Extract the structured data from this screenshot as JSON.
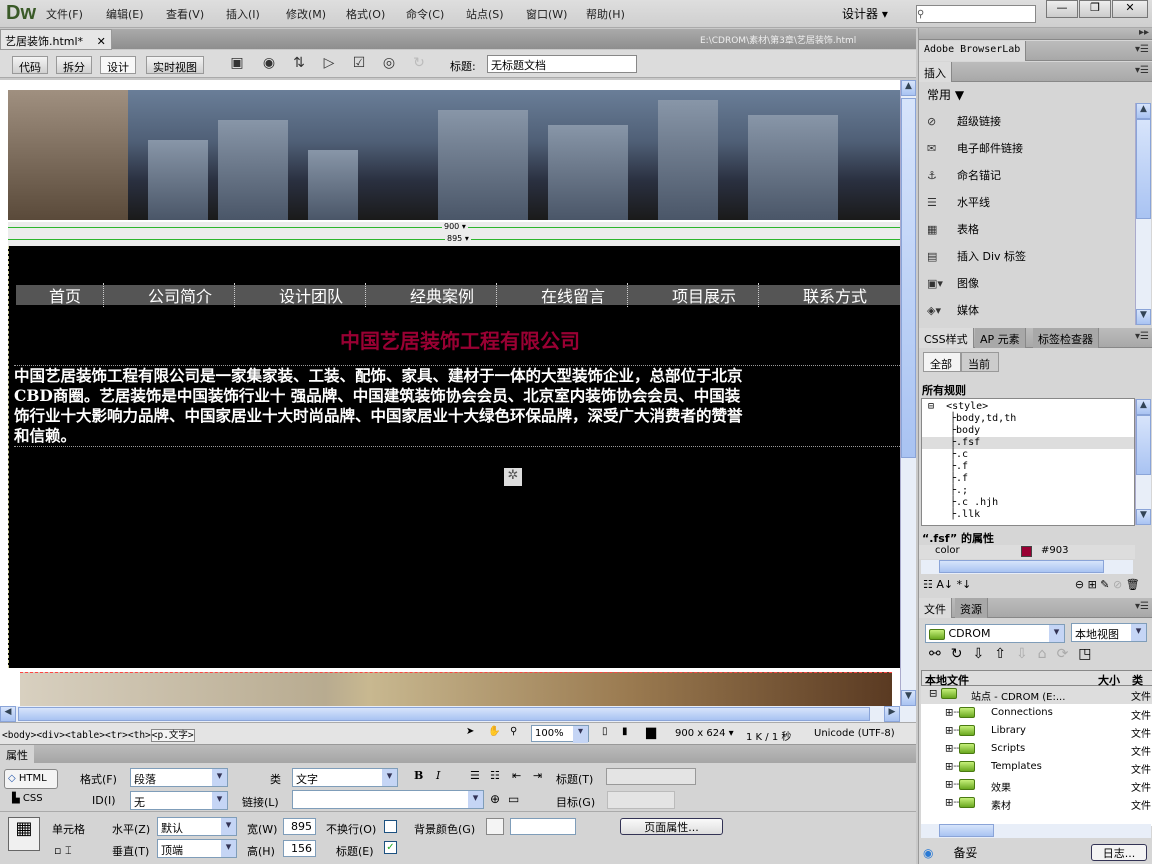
{
  "app": {
    "logo": "Dw",
    "menu": [
      "文件(F)",
      "编辑(E)",
      "查看(V)",
      "插入(I)",
      "修改(M)",
      "格式(O)",
      "命令(C)",
      "站点(S)",
      "窗口(W)",
      "帮助(H)"
    ],
    "workspace": "设计器 ▾",
    "window_buttons": [
      "—",
      "❐",
      "✕"
    ]
  },
  "document": {
    "tab": "艺居装饰.html*",
    "close": "✕",
    "path": "E:\\CDROM\\素材\\第3章\\艺居装饰.html"
  },
  "toolbar": {
    "views": [
      "代码",
      "拆分",
      "设计",
      "实时视图"
    ],
    "active_view": "设计",
    "title_label": "标题:",
    "title_value": "无标题文档",
    "icons": [
      "multiscreen-icon",
      "preview-globe-icon",
      "file-transfer-icon",
      "validate-icon",
      "check-page-icon",
      "visual-aids-icon",
      "refresh-icon"
    ]
  },
  "design": {
    "ruler_outer": "900 ▾",
    "ruler_inner": "895 ▾",
    "nav": [
      "首页",
      "公司简介",
      "设计团队",
      "经典案例",
      "在线留言",
      "项目展示",
      "联系方式"
    ],
    "headline": "中国艺居装饰工程有限公司",
    "headline_color": "#990033",
    "paragraph": [
      "中国艺居装饰工程有限公司是一家集家装、工装、配饰、家具、建材于一体的大型装饰企业，总部位于北京",
      "CBD商圈。艺居装饰是中国装饰行业十 强品牌、中国建筑装饰协会会员、北京室内装饰协会会员、中国装",
      "饰行业十大影响力品牌、中国家居业十大时尚品牌、中国家居业十大绿色环保品牌，深受广大消费者的赞誉",
      "和信赖。"
    ]
  },
  "status": {
    "tags": [
      "<body>",
      "<div>",
      "<table>",
      "<tr>",
      "<th>",
      "<p.文字>"
    ],
    "zoom": "100%",
    "size": "900 x 624 ▾",
    "download": "1 K / 1 秒",
    "encoding": "Unicode (UTF-8)"
  },
  "properties": {
    "tab": "属性",
    "html": "HTML",
    "css": "CSS",
    "format_label": "格式(F)",
    "format": "段落",
    "id_label": "ID(I)",
    "id": "无",
    "class_label": "类",
    "class": "文字",
    "link_label": "链接(L)",
    "link": "",
    "bold": "B",
    "italic": "I",
    "title_label": "标题(T)",
    "target_label": "目标(G)",
    "cell_label": "单元格",
    "horz_label": "水平(Z)",
    "horz": "默认",
    "vert_label": "垂直(T)",
    "vert": "顶端",
    "width_label": "宽(W)",
    "width": "895",
    "height_label": "高(H)",
    "height": "156",
    "nowrap_label": "不换行(O)",
    "nowrap": false,
    "header_label": "标题(E)",
    "header": true,
    "bgcolor_label": "背景颜色(G)",
    "page_props": "页面属性..."
  },
  "panels": {
    "browserlab": "Adobe BrowserLab",
    "insert": {
      "tab": "插入",
      "category": "常用",
      "items": [
        {
          "icon": "hyperlink-icon",
          "label": "超级链接"
        },
        {
          "icon": "email-link-icon",
          "label": "电子邮件链接"
        },
        {
          "icon": "anchor-icon",
          "label": "命名锚记"
        },
        {
          "icon": "horizontal-rule-icon",
          "label": "水平线"
        },
        {
          "icon": "table-icon",
          "label": "表格"
        },
        {
          "icon": "div-tag-icon",
          "label": "插入 Div 标签"
        },
        {
          "icon": "image-icon",
          "label": "图像"
        },
        {
          "icon": "media-icon",
          "label": "媒体"
        }
      ]
    },
    "css": {
      "tabs": [
        "CSS样式",
        "AP 元素",
        "标签检查器"
      ],
      "modes": [
        "全部",
        "当前"
      ],
      "all_rules": "所有规则",
      "rules": [
        "<style>",
        "body,td,th",
        "body",
        ".fsf",
        ".c",
        ".f",
        ".f",
        ".;",
        ".c .hjh",
        ".llk"
      ],
      "selected_rule": ".fsf",
      "props_title": "“.fsf” 的属性",
      "prop_name": "color",
      "prop_value": "#903"
    },
    "files": {
      "tabs": [
        "文件",
        "资源"
      ],
      "site": "CDROM",
      "view": "本地视图",
      "col_local": "本地文件",
      "col_size": "大小",
      "col_type": "类型",
      "root": "站点 - CDROM (E:...",
      "root_type": "文件",
      "folders": [
        {
          "name": "Connections",
          "type": "文件"
        },
        {
          "name": "Library",
          "type": "文件"
        },
        {
          "name": "Scripts",
          "type": "文件"
        },
        {
          "name": "Templates",
          "type": "文件"
        },
        {
          "name": "效果",
          "type": "文件"
        },
        {
          "name": "素材",
          "type": "文件"
        }
      ],
      "ready": "备妥",
      "log": "日志..."
    }
  }
}
